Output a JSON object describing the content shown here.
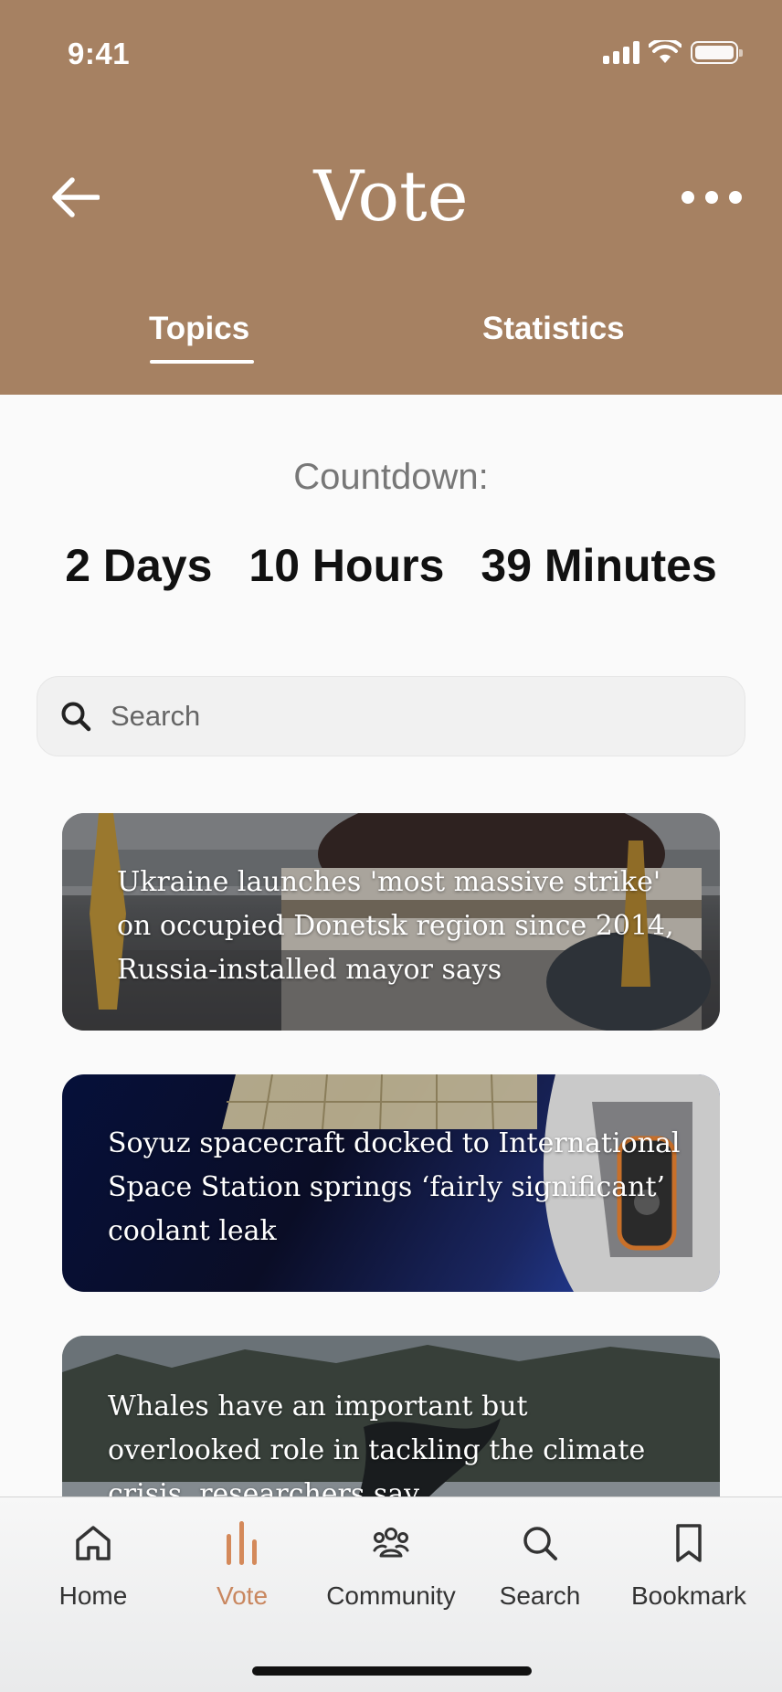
{
  "status": {
    "time": "9:41"
  },
  "header": {
    "title": "Vote"
  },
  "tabs": [
    {
      "label": "Topics",
      "active": true
    },
    {
      "label": "Statistics",
      "active": false
    }
  ],
  "countdown": {
    "label": "Countdown:",
    "days": "2 Days",
    "hours": "10 Hours",
    "minutes": "39 Minutes"
  },
  "search": {
    "placeholder": "Search",
    "value": ""
  },
  "cards": [
    {
      "title": "Ukraine launches 'most massive strike' on occupied Donetsk region since 2014, Russia-installed mayor says"
    },
    {
      "title": "Soyuz spacecraft docked to International Space Station springs ‘fairly significant’ coolant leak"
    },
    {
      "title": "Whales have an important but overlooked role in tackling the climate crisis, researchers say"
    }
  ],
  "tabbar": [
    {
      "label": "Home",
      "icon": "home-icon",
      "active": false
    },
    {
      "label": "Vote",
      "icon": "vote-icon",
      "active": true
    },
    {
      "label": "Community",
      "icon": "community-icon",
      "active": false
    },
    {
      "label": "Search",
      "icon": "search-icon",
      "active": false
    },
    {
      "label": "Bookmark",
      "icon": "bookmark-icon",
      "active": false
    }
  ],
  "colors": {
    "header_bg": "#a68162",
    "accent": "#c9875f",
    "background": "#fafafa"
  }
}
